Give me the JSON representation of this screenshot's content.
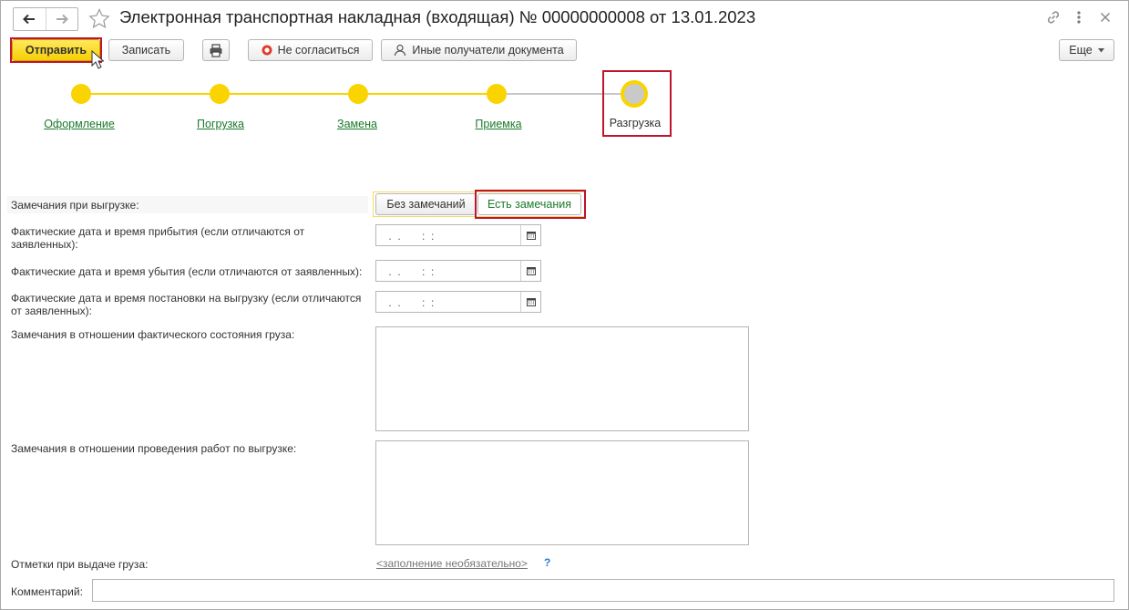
{
  "window": {
    "title": "Электронная транспортная накладная (входящая) № 00000000008 от 13.01.2023"
  },
  "toolbar": {
    "send_label": "Отправить",
    "save_label": "Записать",
    "disagree_label": "Не согласиться",
    "recipients_label": "Иные получатели документа",
    "more_label": "Еще"
  },
  "stepper": {
    "steps": [
      {
        "label": "Оформление",
        "state": "done"
      },
      {
        "label": "Погрузка",
        "state": "done"
      },
      {
        "label": "Замена",
        "state": "done"
      },
      {
        "label": "Приемка",
        "state": "done"
      },
      {
        "label": "Разгрузка",
        "state": "current"
      }
    ],
    "colors": {
      "done": "#f9d400",
      "current": "#c9c9c9",
      "link": "#1a7a2a"
    }
  },
  "form": {
    "remarks_label": "Замечания при выгрузке:",
    "remarks_options": [
      "Без замечаний",
      "Есть замечания"
    ],
    "remarks_selected": "Есть замечания",
    "arrival_label": "Фактические дата и время прибытия (если отличаются от заявленных):",
    "departure_label": "Фактические дата и время убытия (если отличаются от заявленных):",
    "unloading_label": "Фактические дата и время постановки на выгрузку (если отличаются от заявленных):",
    "date_mask": " .  .       :  :",
    "cargo_state_label": "Замечания в отношении фактического состояния груза:",
    "works_label": "Замечания в отношении проведения работ по выгрузке:",
    "marks_label": "Отметки при выдаче груза:",
    "marks_link": "<заполнение необязательно>",
    "marks_help": "?",
    "comment_label": "Комментарий:",
    "comment_value": ""
  }
}
